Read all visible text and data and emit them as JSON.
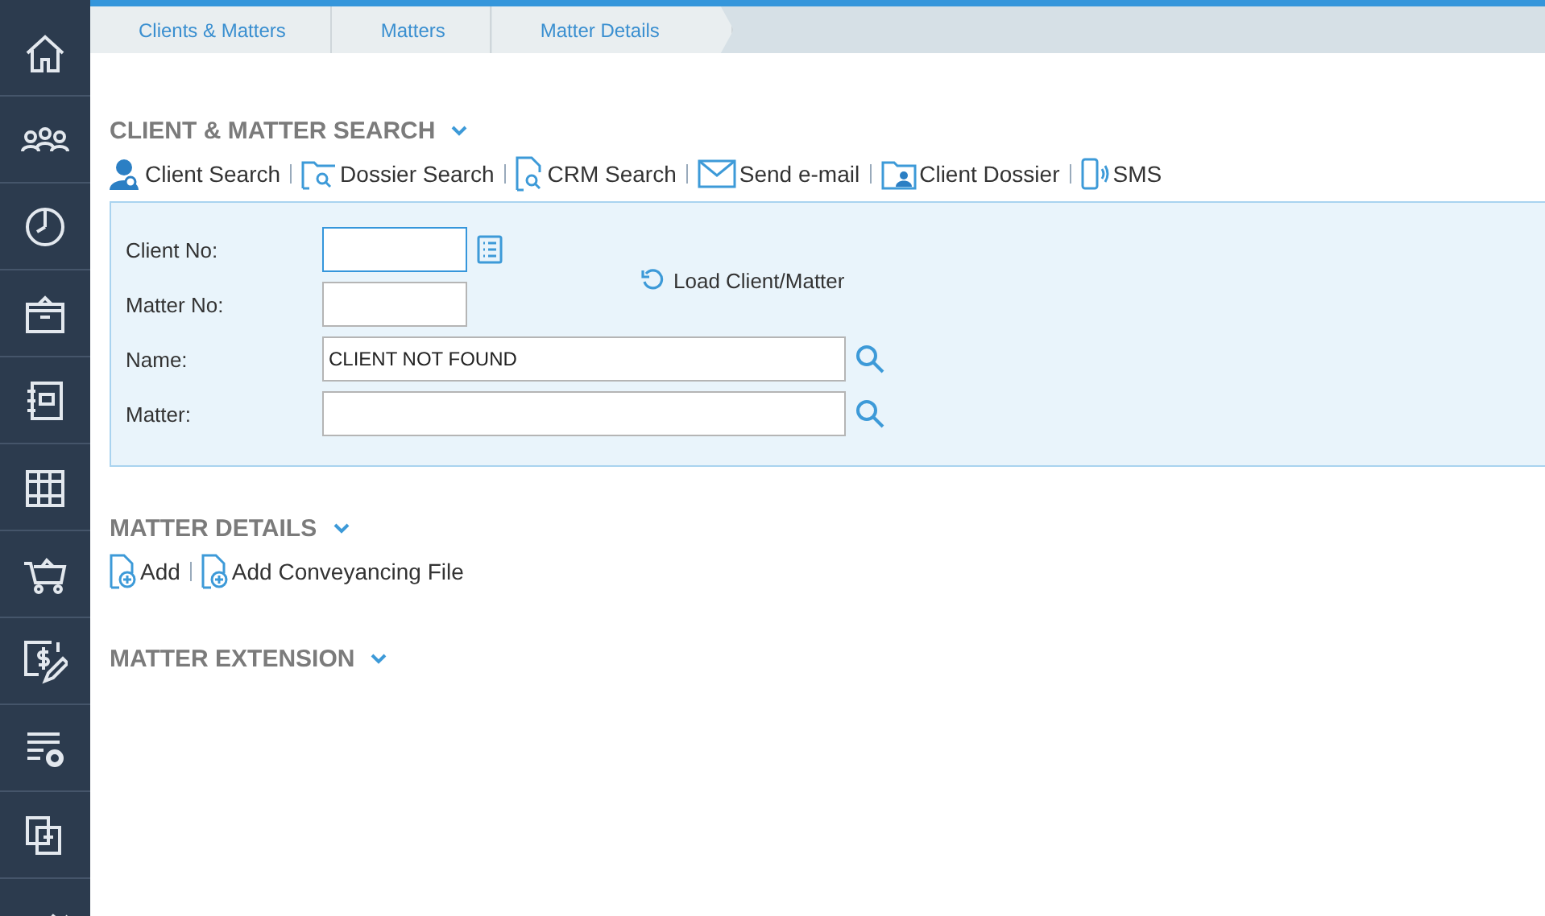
{
  "breadcrumbs": [
    "Clients & Matters",
    "Matters",
    "Matter Details"
  ],
  "search_section": {
    "title": "CLIENT & MATTER SEARCH",
    "expanded": true,
    "actions": [
      "Client Search",
      "Dossier Search",
      "CRM Search",
      "Send e-mail",
      "Client Dossier",
      "SMS"
    ],
    "form": {
      "client_no": {
        "label": "Client No:",
        "focused": true
      },
      "matter_no": {
        "label": "Matter No:"
      },
      "load_button": "Load Client/Matter",
      "name": {
        "label": "Name:",
        "value": "CLIENT NOT FOUND"
      },
      "matter": {
        "label": "Matter:"
      }
    }
  },
  "details_section": {
    "title": "MATTER DETAILS",
    "expanded": true,
    "actions": [
      "Add",
      "Add Conveyancing File"
    ]
  },
  "extension_section": {
    "title": "MATTER EXTENSION",
    "expanded": true
  }
}
